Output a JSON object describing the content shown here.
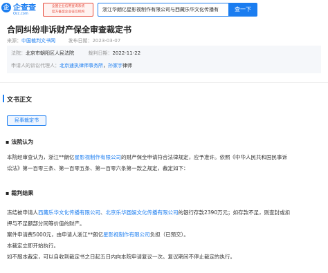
{
  "header": {
    "logo_mark": "企",
    "logo_text": "企查查",
    "logo_sub": "Qcc.com",
    "badge_line1": "全国企业信用查询系统",
    "badge_line2": "官方备案企业征信机构",
    "search_value": "浙江华朗亿星影视制作有限公司与西藏乐华文化传播有",
    "search_button": "查一下"
  },
  "doc": {
    "title": "合同纠纷非诉财产保全审查裁定书",
    "source_label": "来源：",
    "source_value": "中国裁判文书网",
    "publish_label": "发布日期：",
    "publish_date": "2023-03-07",
    "court_label": "法院：",
    "court_value": "北京市朝阳区人民法院",
    "judgment_label": "裁判日期：",
    "judgment_date": "2022-11-22",
    "agent_label": "申请人的诉讼代理人：",
    "agent_firm": "北京速执律师事务所",
    "agent_sep": "，",
    "agent_person": "孙家宇",
    "agent_suffix": "律师"
  },
  "section": {
    "title": "文书正文",
    "tag": "民事裁定书"
  },
  "body": {
    "h1": "法院认为",
    "p1_a": "本院经审查认为，浙江**朗亿",
    "p1_link": "星影视制作有限公司",
    "p1_b": "的财产保全申请符合法律规定，应予准许。依照《中华人民共和国民事诉",
    "p1_c": "讼法》第一百零三条、第一百零五条、第一百零六条第一款之规定，裁定如下：",
    "h2": "裁判结果",
    "p2_a": "冻结被申请人",
    "p2_link1": "西藏乐华文化传播有限公司",
    "p2_b": "、",
    "p2_link2": "北京乐华圆娱文化传播有限公司",
    "p2_c": "的银行存款2390万元；如存款不足，则查封或扣",
    "p2_d": "押与不足额部分同等价值的财产。",
    "p3_a": "案件申请费5000元，由申请人浙江**朗亿",
    "p3_link": "星影视制作有限公司",
    "p3_b": "负担（已预交）。",
    "p4": "本裁定立即开始执行。",
    "p5": "如不服本裁定，可以自收到裁定书之日起五日内向本院申请复议一次。复议期间不停止裁定的执行。"
  }
}
